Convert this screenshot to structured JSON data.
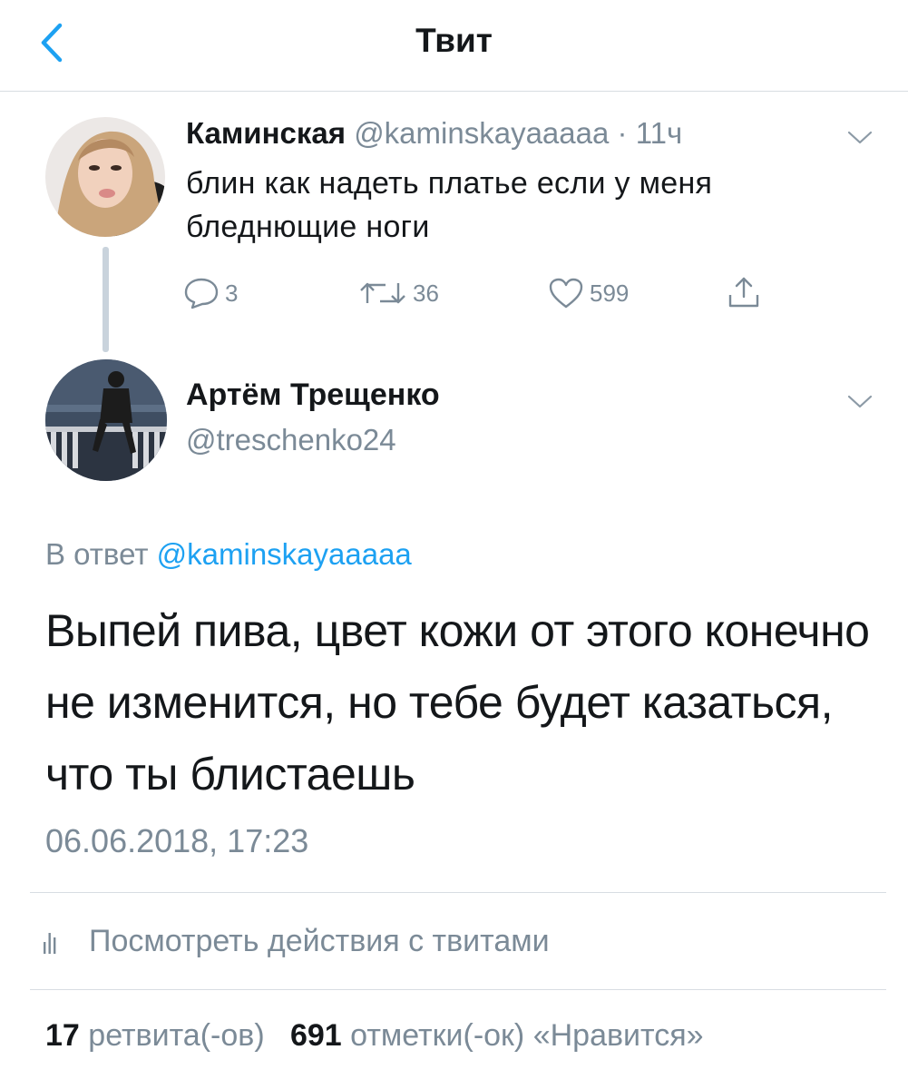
{
  "header": {
    "title": "Твит",
    "back_icon": "chevron-left-icon"
  },
  "parent_tweet": {
    "author_name": "Каминская",
    "handle": "@kaminskayaaaaa",
    "separator": "·",
    "time": "11ч",
    "text": "блин как надеть платье если у меня бледнющие ноги",
    "replies": "3",
    "retweets": "36",
    "likes": "599"
  },
  "main_tweet": {
    "author_name": "Артём Трещенко",
    "handle": "@treschenko24",
    "reply_prefix": "В ответ",
    "reply_to": "@kaminskayaaaaa",
    "text": "Выпей пива, цвет кожи от этого конечно не изменится, но тебе будет казаться, что ты блистаешь",
    "timestamp": "06.06.2018, 17:23"
  },
  "activity": {
    "label": "Посмотреть действия с твитами"
  },
  "stats": {
    "retweets_count": "17",
    "retweets_label": "ретвита(-ов)",
    "likes_count": "691",
    "likes_label": "отметки(-ок) «Нравится»"
  },
  "colors": {
    "accent": "#1da1f2",
    "muted": "#7b8a97",
    "text": "#14171a",
    "divider": "#d8dde2"
  }
}
